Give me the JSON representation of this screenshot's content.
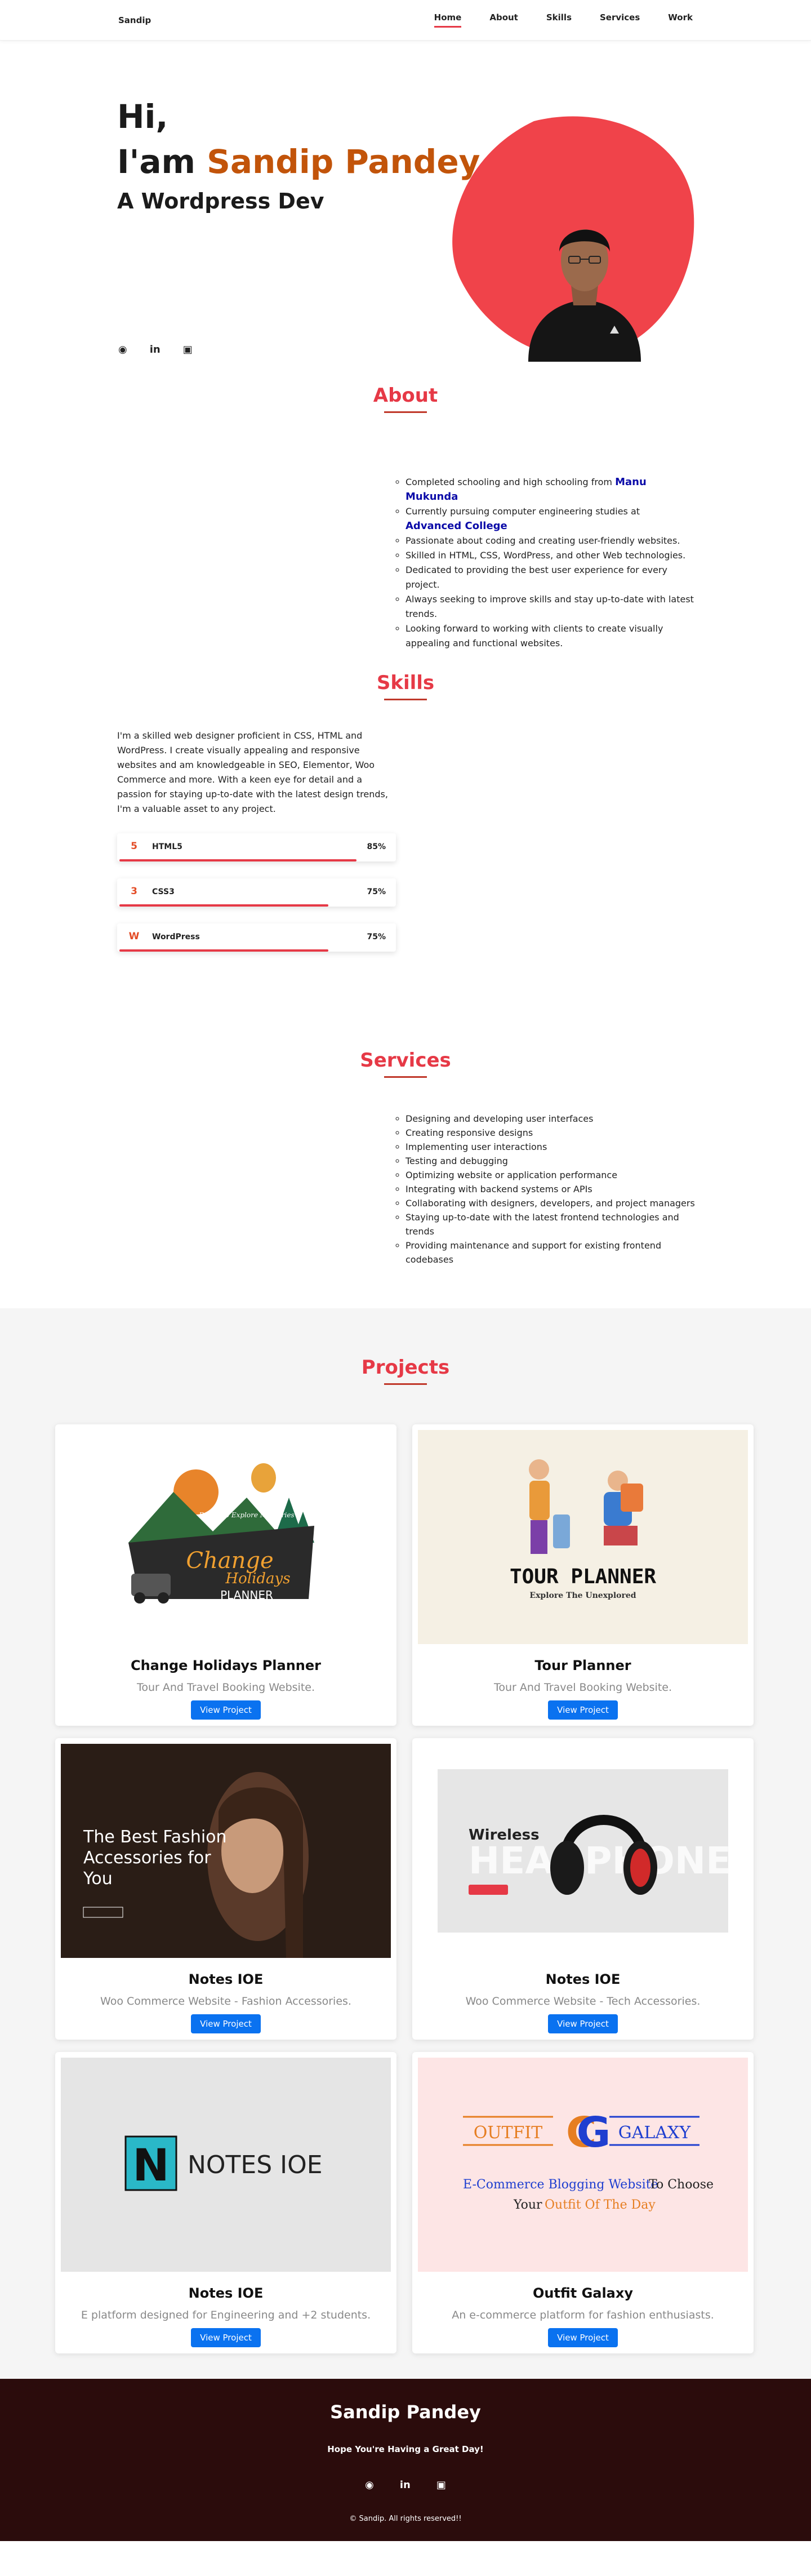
{
  "nav": {
    "brand": "Sandip",
    "items": [
      "Home",
      "About",
      "Skills",
      "Services",
      "Work"
    ]
  },
  "hero": {
    "greeting": "Hi,",
    "name_prefix": "I'am ",
    "name": "Sandip Pandey",
    "role": "A Wordpress Dev",
    "social_icons": [
      "github-icon",
      "linkedin-icon",
      "instagram-icon"
    ]
  },
  "about": {
    "title": "About",
    "items": [
      {
        "text": "Completed schooling and high schooling from ",
        "link": "Manu Mukunda"
      },
      {
        "text": "Currently pursuing computer engineering studies at ",
        "link": "Advanced College"
      },
      {
        "text": "Passionate about coding and creating user-friendly websites."
      },
      {
        "text": "Skilled in HTML, CSS, WordPress, and other Web technologies."
      },
      {
        "text": "Dedicated to providing the best user experience for every project."
      },
      {
        "text": "Always seeking to improve skills and stay up-to-date with latest trends."
      },
      {
        "text": "Looking forward to working with clients to create visually appealing and functional websites."
      }
    ]
  },
  "skills": {
    "title": "Skills",
    "intro": "I'm a skilled web designer proficient in CSS, HTML and WordPress. I create visually appealing and responsive websites and am knowledgeable in SEO, Elementor, Woo Commerce and more. With a keen eye for detail and a passion for staying up-to-date with the latest design trends, I'm a valuable asset to any project.",
    "items": [
      {
        "name": "HTML5",
        "percent": "85%",
        "level": 0.85,
        "icon": "html5-icon"
      },
      {
        "name": "CSS3",
        "percent": "75%",
        "level": 0.75,
        "icon": "css3-icon"
      },
      {
        "name": "WordPress",
        "percent": "75%",
        "level": 0.75,
        "icon": "wordpress-icon"
      }
    ]
  },
  "services": {
    "title": "Services",
    "items": [
      "Designing and developing user interfaces",
      "Creating responsive designs",
      "Implementing user interactions",
      "Testing and debugging",
      "Optimizing website or application performance",
      "Integrating with backend systems or APIs",
      "Collaborating with designers, developers, and project managers",
      "Staying up-to-date with the latest frontend technologies and trends",
      "Providing maintenance and support for existing frontend codebases"
    ]
  },
  "projects": {
    "title": "Projects",
    "button_label": "View Project",
    "items": [
      {
        "title": "Change Holidays Planner",
        "desc": "Tour And Travel Booking Website.",
        "thumb_text": [
          "Change",
          "Holidays",
          "PLANNER",
          "Ready to Explore Memories"
        ]
      },
      {
        "title": "Tour Planner",
        "desc": "Tour And Travel Booking Website.",
        "thumb_text": [
          "TOUR PLANNER",
          "Explore The Unexplored"
        ]
      },
      {
        "title": "Notes IOE",
        "desc": "Woo Commerce Website - Fashion Accessories.",
        "thumb_text": [
          "The Best Fashion Accessories for You"
        ]
      },
      {
        "title": "Notes IOE",
        "desc": "Woo Commerce Website - Tech Accessories.",
        "thumb_text": [
          "Wireless",
          "HEADPHONE"
        ]
      },
      {
        "title": "Notes IOE",
        "desc": "E platform designed for Engineering and +2 students.",
        "thumb_text": [
          "N",
          "NOTES IOE"
        ]
      },
      {
        "title": "Outfit Galaxy",
        "desc": "An e-commerce platform for fashion enthusiasts.",
        "thumb_text": [
          "OUTFIT",
          "GALAXY",
          "E-Commerce Blogging Website",
          "To Choose",
          "Your",
          "Outfit Of The Day"
        ]
      }
    ]
  },
  "footer": {
    "name": "Sandip Pandey",
    "tagline": "Hope You're Having a Great Day!",
    "copyright": "© Sandip. All rights reserved!!"
  },
  "colors": {
    "accent": "#e63946",
    "name_orange": "#c2540a",
    "button_blue": "#0a72f0",
    "footer_bg": "#2b0c0c"
  }
}
